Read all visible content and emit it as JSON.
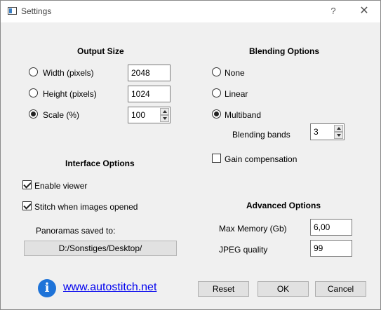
{
  "window": {
    "title": "Settings",
    "help_glyph": "?",
    "close_glyph": "✕"
  },
  "output_size": {
    "title": "Output Size",
    "width": {
      "label": "Width (pixels)",
      "value": "2048",
      "selected": false
    },
    "height": {
      "label": "Height (pixels)",
      "value": "1024",
      "selected": false
    },
    "scale": {
      "label": "Scale (%)",
      "value": "100",
      "selected": true
    }
  },
  "blending": {
    "title": "Blending Options",
    "options": [
      {
        "label": "None",
        "selected": false
      },
      {
        "label": "Linear",
        "selected": false
      },
      {
        "label": "Multiband",
        "selected": true
      }
    ],
    "bands_label": "Blending bands",
    "bands_value": "3",
    "gain_label": "Gain compensation",
    "gain_checked": false
  },
  "interface": {
    "title": "Interface Options",
    "enable_viewer_label": "Enable viewer",
    "enable_viewer_checked": true,
    "stitch_label": "Stitch when images opened",
    "stitch_checked": true,
    "saved_to_label": "Panoramas saved to:",
    "saved_path": "D:/Sonstiges/Desktop/"
  },
  "advanced": {
    "title": "Advanced Options",
    "max_memory_label": "Max Memory (Gb)",
    "max_memory_value": "6,00",
    "jpeg_label": "JPEG quality",
    "jpeg_value": "99"
  },
  "footer": {
    "info_glyph": "i",
    "link_text": "www.autostitch.net",
    "reset_label": "Reset",
    "ok_label": "OK",
    "cancel_label": "Cancel"
  },
  "colors": {
    "link": "#0000ee",
    "info_icon": "#1e73d8",
    "window_bg": "#f0f0f0"
  }
}
